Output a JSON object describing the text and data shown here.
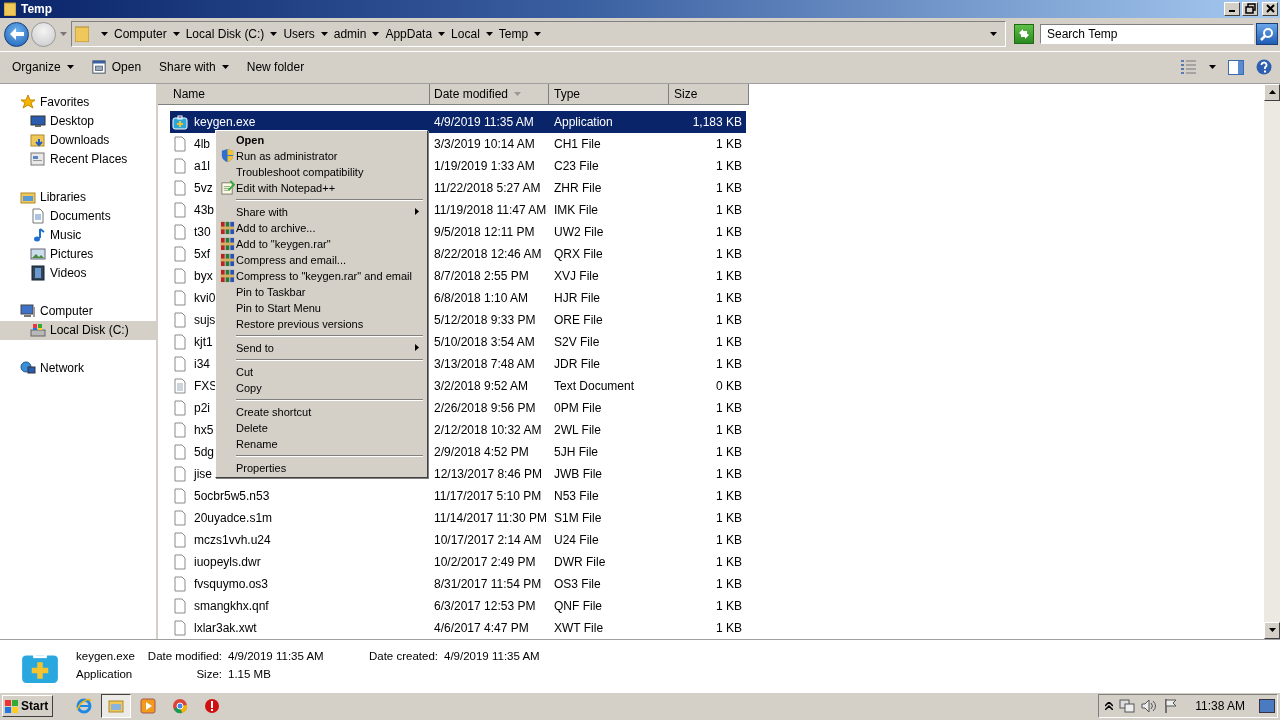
{
  "window": {
    "title": "Temp"
  },
  "address_bar": {
    "breadcrumbs": [
      "Computer",
      "Local Disk (C:)",
      "Users",
      "admin",
      "AppData",
      "Local",
      "Temp"
    ]
  },
  "search": {
    "placeholder": "Search Temp"
  },
  "toolbar": {
    "buttons": [
      {
        "label": "Organize",
        "kind": "menu"
      },
      {
        "label": "Open",
        "kind": "open"
      },
      {
        "label": "Share with",
        "kind": "menu"
      },
      {
        "label": "New folder",
        "kind": "plain"
      }
    ]
  },
  "sidebar": {
    "groups": [
      {
        "label": "Favorites",
        "kind": "star",
        "selected": false,
        "children": [
          {
            "label": "Desktop",
            "kind": "desktop",
            "selected": false
          },
          {
            "label": "Downloads",
            "kind": "downloads",
            "selected": false
          },
          {
            "label": "Recent Places",
            "kind": "recent",
            "selected": false
          }
        ]
      },
      {
        "label": "Libraries",
        "kind": "library",
        "selected": false,
        "children": [
          {
            "label": "Documents",
            "kind": "document",
            "selected": false
          },
          {
            "label": "Music",
            "kind": "music",
            "selected": false
          },
          {
            "label": "Pictures",
            "kind": "pictures",
            "selected": false
          },
          {
            "label": "Videos",
            "kind": "videos",
            "selected": false
          }
        ]
      },
      {
        "label": "Computer",
        "kind": "computer",
        "selected": false,
        "children": [
          {
            "label": "Local Disk (C:)",
            "kind": "disk",
            "selected": true
          }
        ]
      },
      {
        "label": "Network",
        "kind": "network",
        "selected": false
      }
    ]
  },
  "file_list": {
    "columns": [
      {
        "label": "Name",
        "sorted": false
      },
      {
        "label": "Date modified",
        "sorted": true
      },
      {
        "label": "Type",
        "sorted": false
      },
      {
        "label": "Size",
        "sorted": false
      }
    ],
    "rows": [
      {
        "name": "keygen.exe",
        "date_modified": "4/9/2019 11:35 AM",
        "type": "Application",
        "size": "1,183 KB",
        "kind": "app",
        "selected": true
      },
      {
        "name": "4lb",
        "date_modified": "3/3/2019 10:14 AM",
        "type": "CH1 File",
        "size": "1 KB",
        "kind": "file",
        "selected": false
      },
      {
        "name": "a1l",
        "date_modified": "1/19/2019 1:33 AM",
        "type": "C23 File",
        "size": "1 KB",
        "kind": "file",
        "selected": false
      },
      {
        "name": "5vz",
        "date_modified": "11/22/2018 5:27 AM",
        "type": "ZHR File",
        "size": "1 KB",
        "kind": "file",
        "selected": false
      },
      {
        "name": "43b",
        "date_modified": "11/19/2018 11:47 AM",
        "type": "IMK File",
        "size": "1 KB",
        "kind": "file",
        "selected": false
      },
      {
        "name": "t30",
        "date_modified": "9/5/2018 12:11 PM",
        "type": "UW2 File",
        "size": "1 KB",
        "kind": "file",
        "selected": false
      },
      {
        "name": "5xf",
        "date_modified": "8/22/2018 12:46 AM",
        "type": "QRX File",
        "size": "1 KB",
        "kind": "file",
        "selected": false
      },
      {
        "name": "byx",
        "date_modified": "8/7/2018 2:55 PM",
        "type": "XVJ File",
        "size": "1 KB",
        "kind": "file",
        "selected": false
      },
      {
        "name": "kvi0",
        "date_modified": "6/8/2018 1:10 AM",
        "type": "HJR File",
        "size": "1 KB",
        "kind": "file",
        "selected": false
      },
      {
        "name": "sujs",
        "date_modified": "5/12/2018 9:33 PM",
        "type": "ORE File",
        "size": "1 KB",
        "kind": "file",
        "selected": false
      },
      {
        "name": "kjt1",
        "date_modified": "5/10/2018 3:54 AM",
        "type": "S2V File",
        "size": "1 KB",
        "kind": "file",
        "selected": false
      },
      {
        "name": "i34",
        "date_modified": "3/13/2018 7:48 AM",
        "type": "JDR File",
        "size": "1 KB",
        "kind": "file",
        "selected": false
      },
      {
        "name": "FXS",
        "date_modified": "3/2/2018 9:52 AM",
        "type": "Text Document",
        "size": "0 KB",
        "kind": "text",
        "selected": false
      },
      {
        "name": "p2i",
        "date_modified": "2/26/2018 9:56 PM",
        "type": "0PM File",
        "size": "1 KB",
        "kind": "file",
        "selected": false
      },
      {
        "name": "hx5",
        "date_modified": "2/12/2018 10:32 AM",
        "type": "2WL File",
        "size": "1 KB",
        "kind": "file",
        "selected": false
      },
      {
        "name": "5dg",
        "date_modified": "2/9/2018 4:52 PM",
        "type": "5JH File",
        "size": "1 KB",
        "kind": "file",
        "selected": false
      },
      {
        "name": "jise",
        "date_modified": "12/13/2017 8:46 PM",
        "type": "JWB File",
        "size": "1 KB",
        "kind": "file",
        "selected": false
      },
      {
        "name": "5ocbr5w5.n53",
        "date_modified": "11/17/2017 5:10 PM",
        "type": "N53 File",
        "size": "1 KB",
        "kind": "file",
        "selected": false
      },
      {
        "name": "20uyadce.s1m",
        "date_modified": "11/14/2017 11:30 PM",
        "type": "S1M File",
        "size": "1 KB",
        "kind": "file",
        "selected": false
      },
      {
        "name": "mczs1vvh.u24",
        "date_modified": "10/17/2017 2:14 AM",
        "type": "U24 File",
        "size": "1 KB",
        "kind": "file",
        "selected": false
      },
      {
        "name": "iuopeyls.dwr",
        "date_modified": "10/2/2017 2:49 PM",
        "type": "DWR File",
        "size": "1 KB",
        "kind": "file",
        "selected": false
      },
      {
        "name": "fvsquymo.os3",
        "date_modified": "8/31/2017 11:54 PM",
        "type": "OS3 File",
        "size": "1 KB",
        "kind": "file",
        "selected": false
      },
      {
        "name": "smangkhx.qnf",
        "date_modified": "6/3/2017 12:53 PM",
        "type": "QNF File",
        "size": "1 KB",
        "kind": "file",
        "selected": false
      },
      {
        "name": "lxlar3ak.xwt",
        "date_modified": "4/6/2017 4:47 PM",
        "type": "XWT File",
        "size": "1 KB",
        "kind": "file",
        "selected": false
      }
    ]
  },
  "context_menu": {
    "items": [
      {
        "label": "Open",
        "kind": "default"
      },
      {
        "label": "Run as administrator",
        "kind": "shield"
      },
      {
        "label": "Troubleshoot compatibility",
        "kind": "plain"
      },
      {
        "label": "Edit with Notepad++",
        "kind": "notepad"
      },
      {
        "kind": "separator"
      },
      {
        "label": "Share with",
        "kind": "submenu"
      },
      {
        "label": "Add to archive...",
        "kind": "archive"
      },
      {
        "label": "Add to \"keygen.rar\"",
        "kind": "archive"
      },
      {
        "label": "Compress and email...",
        "kind": "archive"
      },
      {
        "label": "Compress to \"keygen.rar\" and email",
        "kind": "archive"
      },
      {
        "label": "Pin to Taskbar",
        "kind": "plain"
      },
      {
        "label": "Pin to Start Menu",
        "kind": "plain"
      },
      {
        "label": "Restore previous versions",
        "kind": "plain"
      },
      {
        "kind": "separator"
      },
      {
        "label": "Send to",
        "kind": "submenu"
      },
      {
        "kind": "separator"
      },
      {
        "label": "Cut",
        "kind": "plain"
      },
      {
        "label": "Copy",
        "kind": "plain"
      },
      {
        "kind": "separator"
      },
      {
        "label": "Create shortcut",
        "kind": "plain"
      },
      {
        "label": "Delete",
        "kind": "plain"
      },
      {
        "label": "Rename",
        "kind": "plain"
      },
      {
        "kind": "separator"
      },
      {
        "label": "Properties",
        "kind": "plain"
      }
    ]
  },
  "details_pane": {
    "name": "keygen.exe",
    "type": "Application",
    "fields": [
      {
        "label": "Date modified:",
        "value": "4/9/2019 11:35 AM"
      },
      {
        "label": "Date created:",
        "value": "4/9/2019 11:35 AM"
      },
      {
        "label": "Size:",
        "value": "1.15 MB"
      }
    ]
  },
  "taskbar": {
    "start": "Start",
    "apps": [
      {
        "kind": "ie",
        "selected": false
      },
      {
        "kind": "explorer",
        "selected": true
      },
      {
        "kind": "media",
        "selected": false
      },
      {
        "kind": "chrome",
        "selected": false
      },
      {
        "kind": "stop",
        "selected": false
      }
    ],
    "clock": "11:38 AM"
  }
}
